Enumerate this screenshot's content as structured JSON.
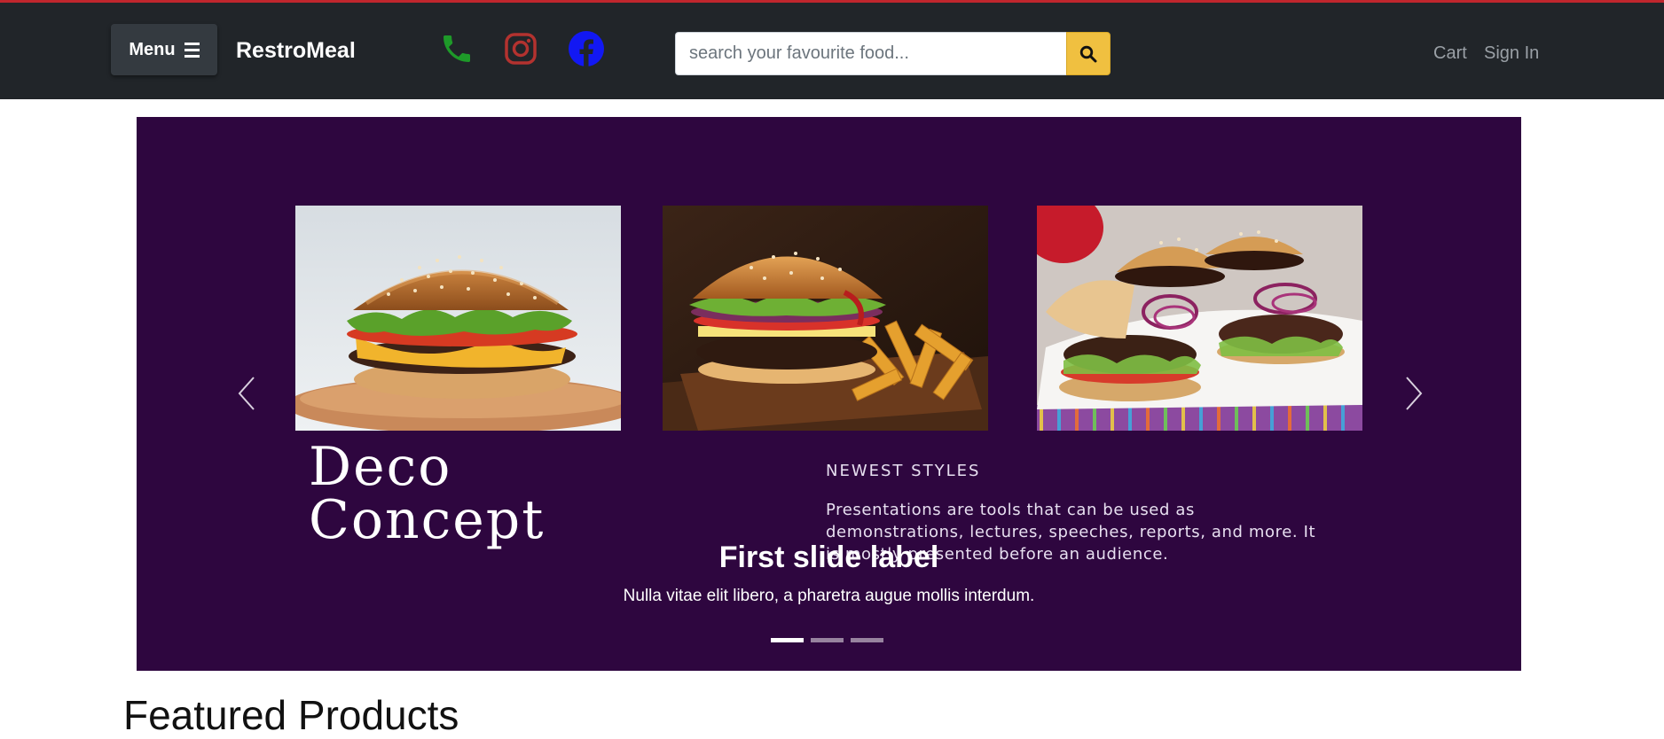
{
  "header": {
    "menu_label": "Menu",
    "brand": "RestroMeal",
    "social_icons": [
      "phone-icon",
      "instagram-icon",
      "facebook-icon"
    ],
    "search_placeholder": "search your favourite food...",
    "nav_links": [
      "Cart",
      "Sign In"
    ],
    "colors": {
      "navbar": "#212529",
      "search_button": "#f0c040",
      "phone": "#1e9a29",
      "instagram": "#b3322f",
      "facebook": "#1218f3"
    }
  },
  "carousel": {
    "images": [
      "burger-on-wooden-plate",
      "burger-with-fries",
      "burgers-on-plate"
    ],
    "deco_line1": "Deco",
    "deco_line2": "Concept",
    "newest_styles": "NEWEST STYLES",
    "description": "Presentations are tools that can be used as demonstrations, lectures, speeches, reports, and more. It is mostly presented before an audience.",
    "caption_title": "First slide label",
    "caption_text": "Nulla vitae elit libero, a pharetra augue mollis interdum.",
    "slide_count": 3,
    "active_slide": 1,
    "background": "#2e063f"
  },
  "section": {
    "featured_title": "Featured Products"
  }
}
